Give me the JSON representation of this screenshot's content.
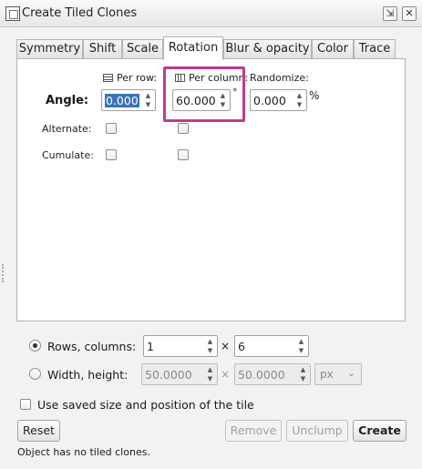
{
  "window": {
    "title": "Create Tiled Clones"
  },
  "tabs": [
    {
      "label": "Symmetry",
      "active": false
    },
    {
      "label": "Shift",
      "active": false
    },
    {
      "label": "Scale",
      "active": false
    },
    {
      "label": "Rotation",
      "active": true
    },
    {
      "label": "Blur & opacity",
      "active": false
    },
    {
      "label": "Color",
      "active": false
    },
    {
      "label": "Trace",
      "active": false
    }
  ],
  "rotation": {
    "col_per_row": "Per row:",
    "col_per_column": "Per column:",
    "col_randomize": "Randomize:",
    "angle_label": "Angle:",
    "angle_per_row": "0.000",
    "angle_per_column": "60.000",
    "angle_unit": "°",
    "angle_randomize": "0.000",
    "randomize_unit": "%",
    "alternate_label": "Alternate:",
    "cumulate_label": "Cumulate:",
    "alternate_per_row": false,
    "alternate_per_column": false,
    "cumulate_per_row": false,
    "cumulate_per_column": false
  },
  "size": {
    "rows_columns_label": "Rows, columns:",
    "rows": "1",
    "times": "×",
    "columns": "6",
    "width_height_label": "Width, height:",
    "width": "50.0000",
    "height": "50.0000",
    "unit": "px",
    "selected_mode": "rows_columns"
  },
  "use_saved": {
    "label": "Use saved size and position of the tile",
    "checked": false
  },
  "buttons": {
    "reset": "Reset",
    "remove": "Remove",
    "unclump": "Unclump",
    "create": "Create"
  },
  "status": "Object has no tiled clones.",
  "colors": {
    "highlight": "#c03a93",
    "selection": "#3b73b9"
  }
}
